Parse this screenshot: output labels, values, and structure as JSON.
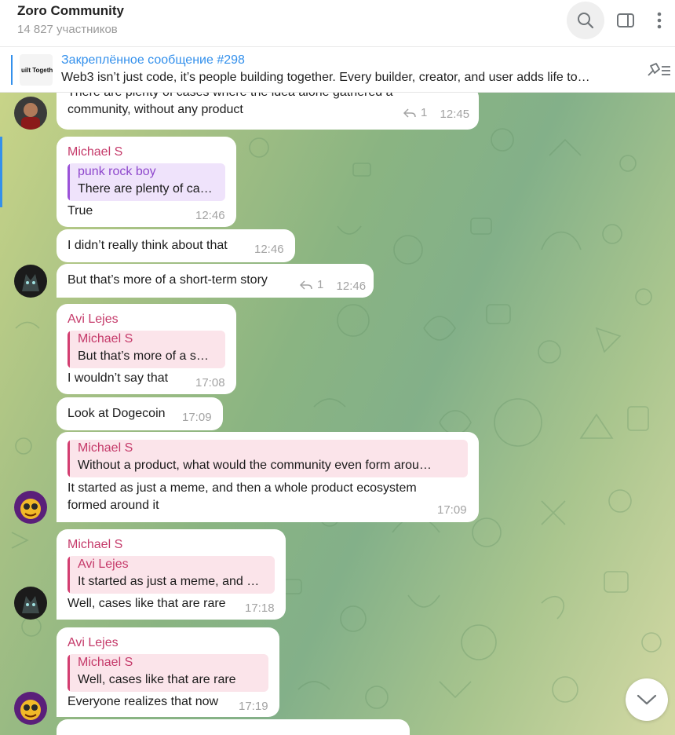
{
  "header": {
    "title": "Zoro Community",
    "subtitle": "14 827 участников",
    "icons": {
      "search": "search-icon",
      "sidebar": "sidebar-toggle-icon",
      "more": "more-vertical-icon"
    }
  },
  "pinned": {
    "title": "Закреплённое сообщение #298",
    "text": "Web3 isn’t just code, it’s people building together. Every builder, creator, and user adds life to…",
    "thumb_text": "uilt Togethe",
    "icon": "pin-list-icon"
  },
  "colors": {
    "accent": "#3390ec",
    "sender_pink": "#c53a6a",
    "sender_purple": "#8e47cc"
  },
  "messages": [
    {
      "sender": "",
      "lines": [
        "There are plenty of cases where the idea alone gathered a",
        "community, without any product"
      ],
      "reply_count": "1",
      "time": "12:45"
    },
    {
      "sender": "Michael S",
      "reply_to": {
        "name": "punk rock boy",
        "text": "There are plenty of ca…"
      },
      "text": "True",
      "time": "12:46"
    },
    {
      "text": "I didn’t really think about that",
      "time": "12:46"
    },
    {
      "text": "But that’s more of a short-term story",
      "reply_count": "1",
      "time": "12:46"
    },
    {
      "sender": "Avi Lejes",
      "reply_to": {
        "name": "Michael S",
        "text": "But that’s more of a s…"
      },
      "text": "I wouldn’t say that",
      "time": "17:08"
    },
    {
      "text": "Look at Dogecoin",
      "time": "17:09"
    },
    {
      "reply_to": {
        "name": "Michael S",
        "text": "Without a product, what would the community even form arou…"
      },
      "lines": [
        "It started as just a meme, and then a whole product ecosystem",
        "formed around it"
      ],
      "time": "17:09"
    },
    {
      "sender": "Michael S",
      "reply_to": {
        "name": "Avi Lejes",
        "text": "It started as just a meme, and …"
      },
      "text": "Well, cases like that are rare",
      "time": "17:18"
    },
    {
      "sender": "Avi Lejes",
      "reply_to": {
        "name": "Michael S",
        "text": "Well, cases like that are rare"
      },
      "text": "Everyone realizes that now",
      "time": "17:19"
    }
  ],
  "scroll_down_icon": "chevron-down-icon"
}
